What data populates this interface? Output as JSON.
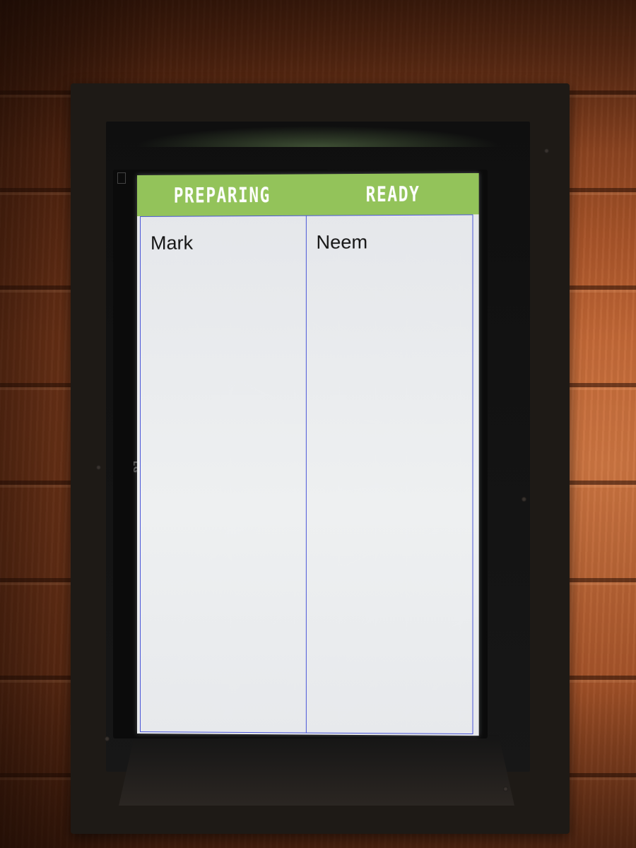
{
  "board": {
    "columns": [
      {
        "title": "PREPARING",
        "orders": [
          "Mark"
        ]
      },
      {
        "title": "READY",
        "orders": [
          "Neem"
        ]
      }
    ]
  },
  "display": {
    "brand": "LG"
  },
  "colors": {
    "header_green": "#93c35a",
    "divider_blue": "#4a56d8",
    "screen_bg": "#eceef0",
    "wall_wood": "#b45a2c",
    "frame": "#1e1a16"
  }
}
